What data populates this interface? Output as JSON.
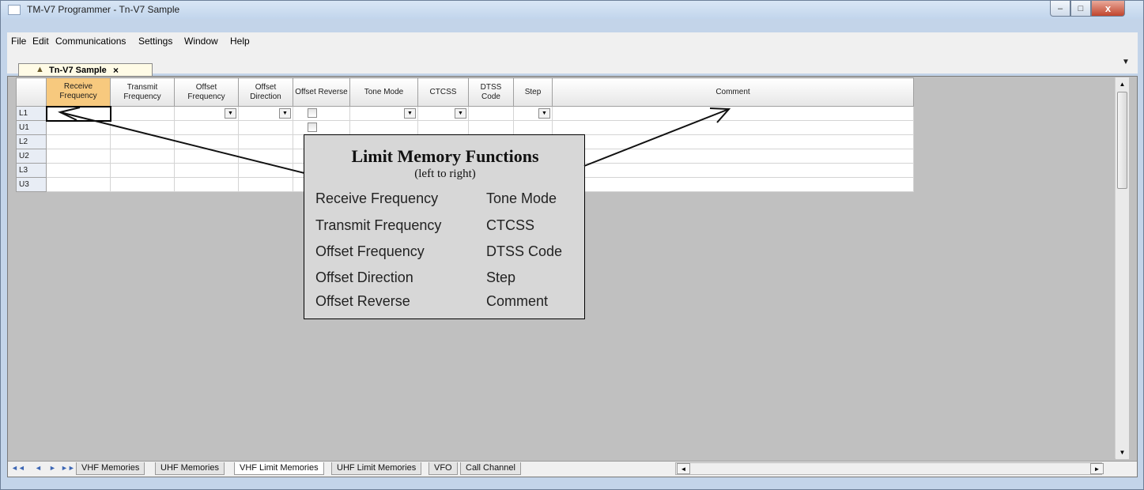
{
  "window": {
    "title": "TM-V7 Programmer - Tn-V7 Sample",
    "minimize": "–",
    "maximize": "□",
    "close": "x"
  },
  "menu": [
    "File",
    "Edit",
    "Communications",
    "Settings",
    "Window",
    "Help"
  ],
  "document_tab": {
    "label": "Tn-V7 Sample",
    "close": "×"
  },
  "grid": {
    "columns": [
      "Receive Frequency",
      "Transmit Frequency",
      "Offset Frequency",
      "Offset Direction",
      "Offset Reverse",
      "Tone Mode",
      "CTCSS",
      "DTSS Code",
      "Step",
      "Comment"
    ],
    "rows": [
      "L1",
      "U1",
      "L2",
      "U2",
      "L3",
      "U3"
    ]
  },
  "callout": {
    "title": "Limit Memory Functions",
    "subtitle": "(left to right)",
    "left": [
      "Receive Frequency",
      "Transmit Frequency",
      "Offset Frequency",
      "Offset Direction",
      "Offset Reverse"
    ],
    "right": [
      "Tone Mode",
      "CTCSS",
      "DTSS Code",
      "Step",
      "Comment"
    ]
  },
  "sheet_tabs": [
    "VHF Memories",
    "UHF Memories",
    "VHF Limit Memories",
    "UHF Limit Memories",
    "VFO",
    "Call Channel"
  ],
  "active_sheet": "VHF Limit Memories",
  "colors": {
    "active_header": "#f7c97e",
    "callout_bg": "#d7d7d7",
    "workspace": "#c0c0c0"
  }
}
